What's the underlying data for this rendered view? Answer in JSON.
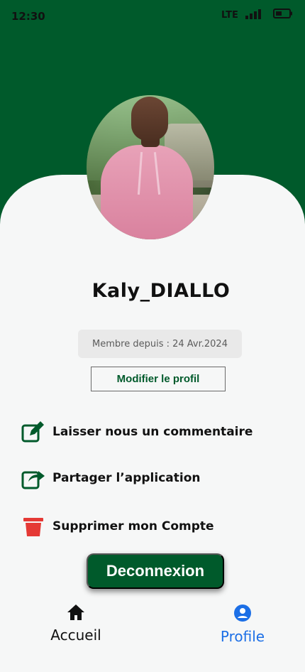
{
  "status_bar": {
    "time": "12:30",
    "network": "LTE"
  },
  "profile": {
    "username": "Kaly_DIALLO",
    "member_since": "Membre depuis : 24 Avr.2024",
    "edit_button": "Modifier le profil"
  },
  "menu": [
    {
      "label": "Laisser nous un commentaire",
      "icon": "edit-icon"
    },
    {
      "label": "Partager l’application",
      "icon": "share-icon"
    },
    {
      "label": "Supprimer mon Compte",
      "icon": "trash-icon"
    }
  ],
  "logout_button": "Deconnexion",
  "tabbar": {
    "home": {
      "label": "Accueil",
      "icon": "home-icon"
    },
    "profile": {
      "label": "Profile",
      "icon": "user-icon"
    }
  },
  "colors": {
    "brand": "#005a2b",
    "active_tab": "#1c6fe6",
    "danger": "#e53935"
  }
}
